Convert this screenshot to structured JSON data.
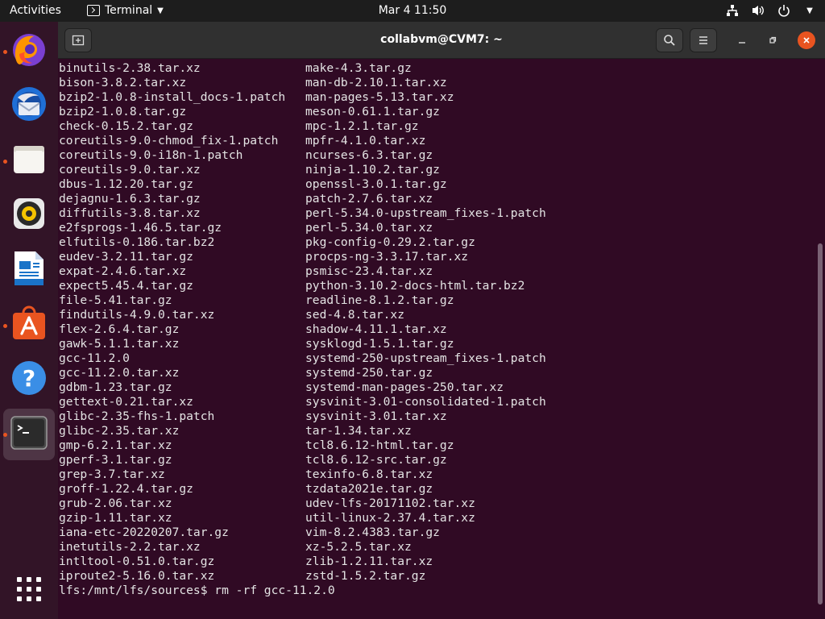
{
  "topbar": {
    "activities": "Activities",
    "app_name": "Terminal",
    "clock": "Mar 4  11:50"
  },
  "window": {
    "title": "collabvm@CVM7: ~"
  },
  "dock": {
    "items": [
      {
        "name": "firefox-icon",
        "running": true
      },
      {
        "name": "thunderbird-icon",
        "running": false
      },
      {
        "name": "files-icon",
        "running": true
      },
      {
        "name": "rhythmbox-icon",
        "running": false
      },
      {
        "name": "libreoffice-writer-icon",
        "running": false
      },
      {
        "name": "ubuntu-software-icon",
        "running": true
      },
      {
        "name": "help-icon",
        "running": false
      },
      {
        "name": "terminal-icon",
        "running": true
      }
    ]
  },
  "terminal": {
    "listing": [
      [
        "binutils-2.38.tar.xz",
        "make-4.3.tar.gz"
      ],
      [
        "bison-3.8.2.tar.xz",
        "man-db-2.10.1.tar.xz"
      ],
      [
        "bzip2-1.0.8-install_docs-1.patch",
        "man-pages-5.13.tar.xz"
      ],
      [
        "bzip2-1.0.8.tar.gz",
        "meson-0.61.1.tar.gz"
      ],
      [
        "check-0.15.2.tar.gz",
        "mpc-1.2.1.tar.gz"
      ],
      [
        "coreutils-9.0-chmod_fix-1.patch",
        "mpfr-4.1.0.tar.xz"
      ],
      [
        "coreutils-9.0-i18n-1.patch",
        "ncurses-6.3.tar.gz"
      ],
      [
        "coreutils-9.0.tar.xz",
        "ninja-1.10.2.tar.gz"
      ],
      [
        "dbus-1.12.20.tar.gz",
        "openssl-3.0.1.tar.gz"
      ],
      [
        "dejagnu-1.6.3.tar.gz",
        "patch-2.7.6.tar.xz"
      ],
      [
        "diffutils-3.8.tar.xz",
        "perl-5.34.0-upstream_fixes-1.patch"
      ],
      [
        "e2fsprogs-1.46.5.tar.gz",
        "perl-5.34.0.tar.xz"
      ],
      [
        "elfutils-0.186.tar.bz2",
        "pkg-config-0.29.2.tar.gz"
      ],
      [
        "eudev-3.2.11.tar.gz",
        "procps-ng-3.3.17.tar.xz"
      ],
      [
        "expat-2.4.6.tar.xz",
        "psmisc-23.4.tar.xz"
      ],
      [
        "expect5.45.4.tar.gz",
        "python-3.10.2-docs-html.tar.bz2"
      ],
      [
        "file-5.41.tar.gz",
        "readline-8.1.2.tar.gz"
      ],
      [
        "findutils-4.9.0.tar.xz",
        "sed-4.8.tar.xz"
      ],
      [
        "flex-2.6.4.tar.gz",
        "shadow-4.11.1.tar.xz"
      ],
      [
        "gawk-5.1.1.tar.xz",
        "sysklogd-1.5.1.tar.gz"
      ],
      [
        "gcc-11.2.0",
        "systemd-250-upstream_fixes-1.patch"
      ],
      [
        "gcc-11.2.0.tar.xz",
        "systemd-250.tar.gz"
      ],
      [
        "gdbm-1.23.tar.gz",
        "systemd-man-pages-250.tar.xz"
      ],
      [
        "gettext-0.21.tar.xz",
        "sysvinit-3.01-consolidated-1.patch"
      ],
      [
        "glibc-2.35-fhs-1.patch",
        "sysvinit-3.01.tar.xz"
      ],
      [
        "glibc-2.35.tar.xz",
        "tar-1.34.tar.xz"
      ],
      [
        "gmp-6.2.1.tar.xz",
        "tcl8.6.12-html.tar.gz"
      ],
      [
        "gperf-3.1.tar.gz",
        "tcl8.6.12-src.tar.gz"
      ],
      [
        "grep-3.7.tar.xz",
        "texinfo-6.8.tar.xz"
      ],
      [
        "groff-1.22.4.tar.gz",
        "tzdata2021e.tar.gz"
      ],
      [
        "grub-2.06.tar.xz",
        "udev-lfs-20171102.tar.xz"
      ],
      [
        "gzip-1.11.tar.xz",
        "util-linux-2.37.4.tar.xz"
      ],
      [
        "iana-etc-20220207.tar.gz",
        "vim-8.2.4383.tar.gz"
      ],
      [
        "inetutils-2.2.tar.xz",
        "xz-5.2.5.tar.xz"
      ],
      [
        "intltool-0.51.0.tar.gz",
        "zlib-1.2.11.tar.xz"
      ],
      [
        "iproute2-5.16.0.tar.xz",
        "zstd-1.5.2.tar.gz"
      ]
    ],
    "prompt_line": "lfs:/mnt/lfs/sources$ rm -rf gcc-11.2.0"
  }
}
